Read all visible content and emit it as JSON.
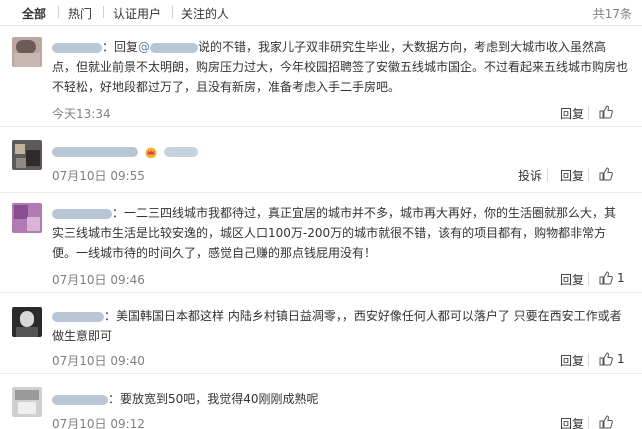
{
  "filter": {
    "tabs": [
      "全部",
      "热门",
      "认证用户",
      "关注的人"
    ],
    "total": "共17条"
  },
  "actions": {
    "reply": "回复",
    "report": "投诉"
  },
  "comments": [
    {
      "prefix": "：回复",
      "at": "@",
      "text": "说的不错，我家儿子双非研究生毕业，大数据方向，考虑到大城市收入虽然高点，但就业前景不太明朗，购房压力过大，今年校园招聘签了安徽五线城市国企。不过看起来五线城市购房也不轻松，好地段都过万了，且没有新房，准备考虑入手二手房吧。",
      "time": "今天13:34"
    },
    {
      "prefix": "",
      "text": "",
      "time": "07月10日 09:55"
    },
    {
      "prefix": "：",
      "text": "一二三四线城市我都待过，真正宜居的城市并不多，城市再大再好，你的生活圈就那么大，其实三线城市生活是比较安逸的，城区人口100万-200万的城市就很不错，该有的项目都有，购物都非常方便。一线城市待的时间久了，感觉自己赚的那点钱屁用没有！",
      "time": "07月10日 09:46",
      "likes": "1"
    },
    {
      "prefix": "：",
      "text": "美国韩国日本都这样 内陆乡村镇日益凋零，，西安好像任何人都可以落户了 只要在西安工作或者做生意即可",
      "time": "07月10日 09:40",
      "likes": "1"
    },
    {
      "prefix": "：",
      "text": "要放宽到50吧，我觉得40刚刚成熟呢",
      "time": "07月10日 09:12"
    }
  ]
}
